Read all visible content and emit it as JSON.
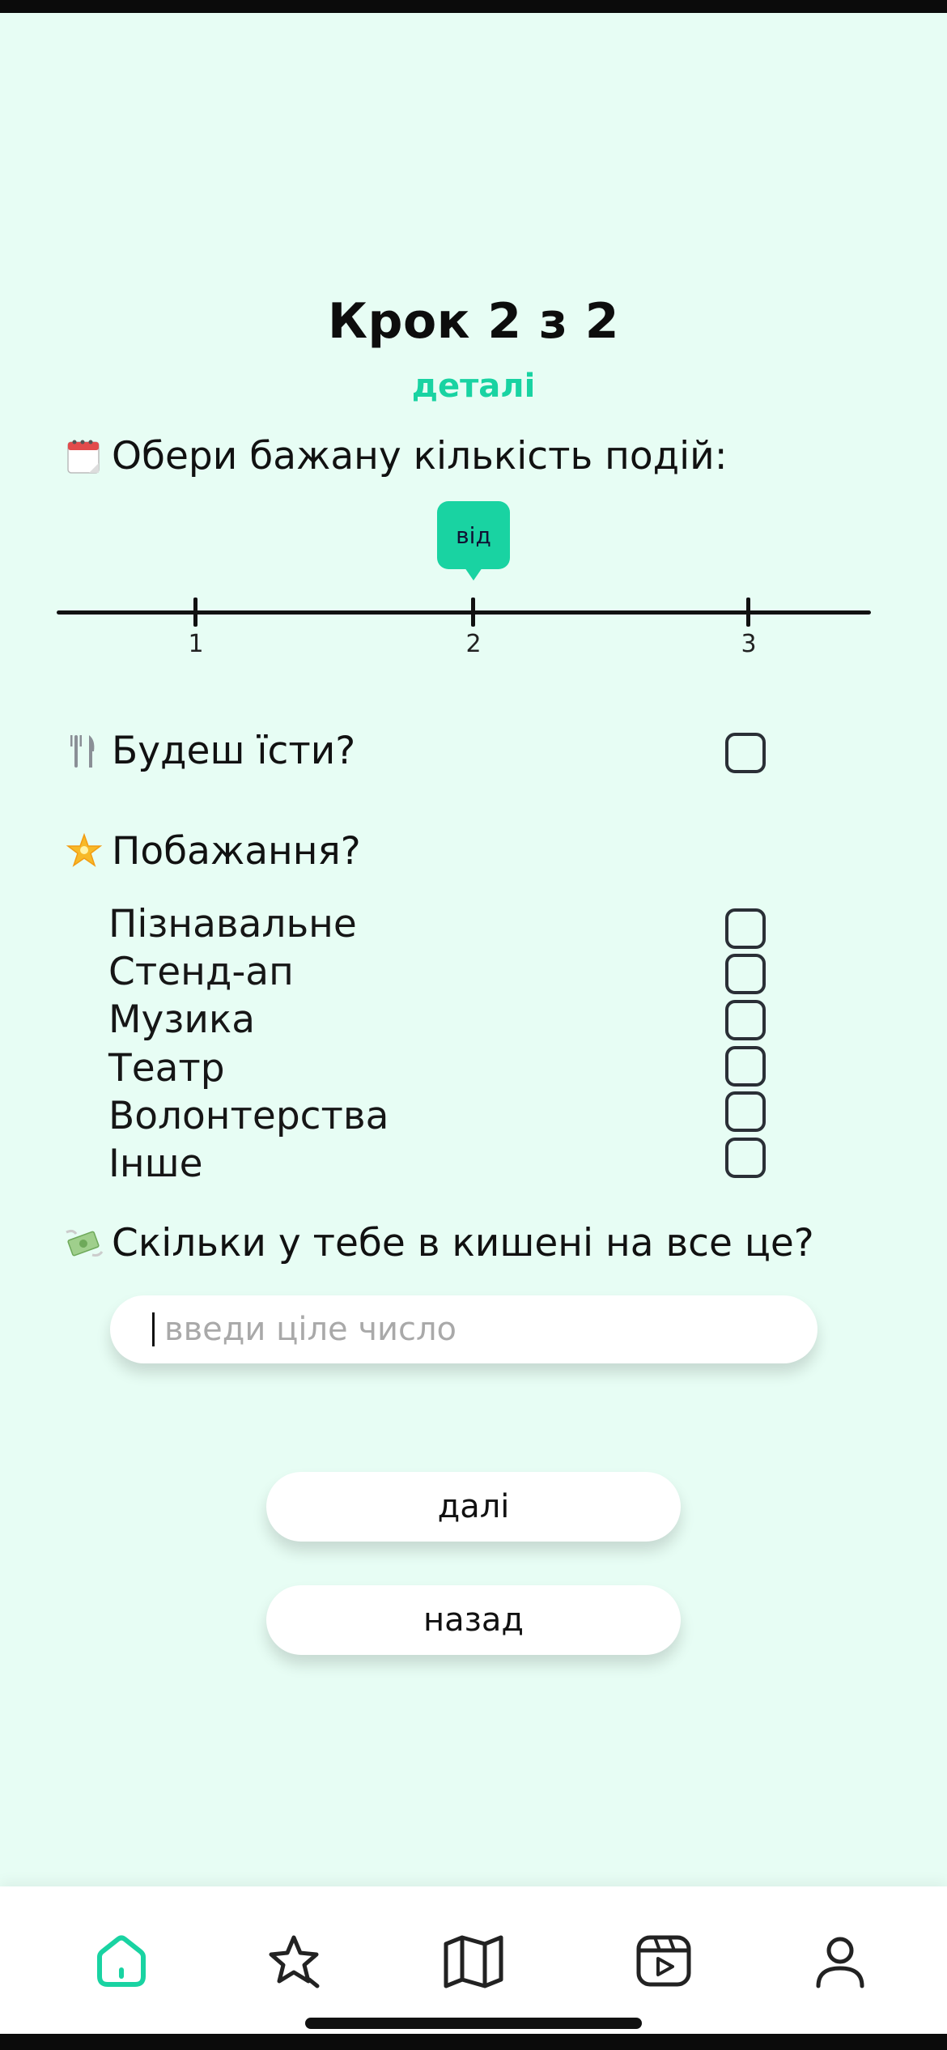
{
  "header": {
    "title": "Крок 2 з 2",
    "subtitle": "деталі"
  },
  "events": {
    "question": "Обери бажану кількість подій:",
    "emoji": "calendar-emoji",
    "slider": {
      "min": 1,
      "max": 3,
      "value": 2,
      "bubble_label": "від",
      "ticks": [
        "1",
        "2",
        "3"
      ]
    }
  },
  "food": {
    "question": "Будеш їсти?",
    "emoji": "fork-knife-emoji",
    "checked": false
  },
  "wishes": {
    "question": "Побажання?",
    "emoji": "star-emoji",
    "options": [
      {
        "label": "Пізнавальне",
        "checked": false
      },
      {
        "label": "Стенд-ап",
        "checked": false
      },
      {
        "label": "Музика",
        "checked": false
      },
      {
        "label": "Театр",
        "checked": false
      },
      {
        "label": "Волонтерства",
        "checked": false
      },
      {
        "label": "Інше",
        "checked": false
      }
    ]
  },
  "budget": {
    "question": "Скільки у тебе в кишені на все це?",
    "emoji": "money-wings-emoji",
    "placeholder": "введи ціле число",
    "value": ""
  },
  "buttons": {
    "next": "далі",
    "back": "назад"
  },
  "nav": {
    "items": [
      {
        "icon": "home-icon",
        "active": true
      },
      {
        "icon": "sparkle-star-icon",
        "active": false
      },
      {
        "icon": "map-icon",
        "active": false
      },
      {
        "icon": "video-icon",
        "active": false
      },
      {
        "icon": "profile-icon",
        "active": false
      }
    ]
  },
  "colors": {
    "background": "#e7fdf4",
    "accent": "#19d3a2",
    "text": "#111111"
  }
}
